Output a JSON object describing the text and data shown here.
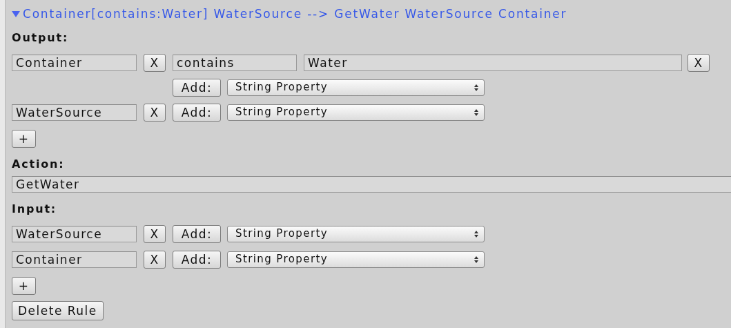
{
  "rule": {
    "title": "Container[contains:Water] WaterSource --> GetWater WaterSource Container",
    "expanded": true
  },
  "output": {
    "label": "Output:",
    "items": [
      {
        "name": "Container",
        "remove": "X",
        "properties": [
          {
            "key": "contains",
            "value": "Water",
            "remove": "X"
          }
        ],
        "add": "Add:",
        "type": "String Property"
      },
      {
        "name": "WaterSource",
        "remove": "X",
        "add": "Add:",
        "type": "String Property"
      }
    ],
    "plus": "+"
  },
  "action": {
    "label": "Action:",
    "value": "GetWater"
  },
  "input": {
    "label": "Input:",
    "items": [
      {
        "name": "WaterSource",
        "remove": "X",
        "add": "Add:",
        "type": "String Property"
      },
      {
        "name": "Container",
        "remove": "X",
        "add": "Add:",
        "type": "String Property"
      }
    ],
    "plus": "+"
  },
  "delete_button": "Delete Rule"
}
